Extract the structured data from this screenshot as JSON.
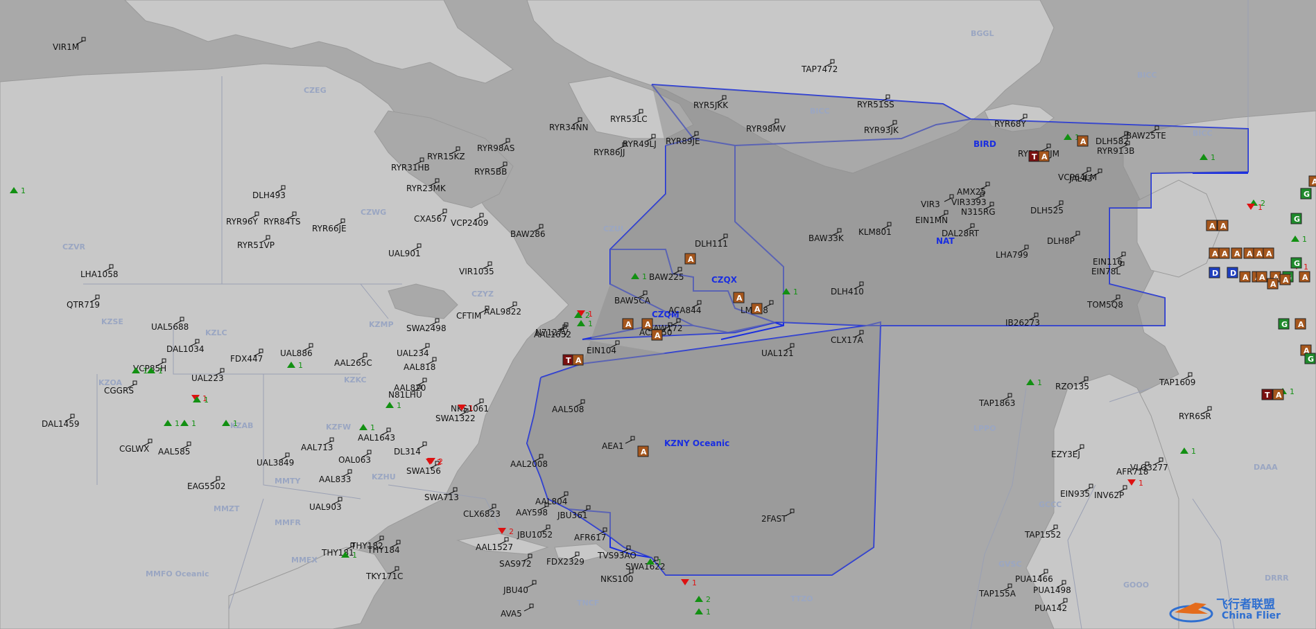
{
  "fir_labels": [
    "BGGL",
    "BICC",
    "BICC",
    "BICC",
    "CZEG",
    "CZWG",
    "CZVR",
    "CZUL",
    "CZYZ",
    "KZSE",
    "KZLC",
    "KZMP",
    "KZOA",
    "KZAB",
    "KZKC",
    "KZFW",
    "KZHU",
    "MMTY",
    "MMZT",
    "MMFR",
    "MMEX",
    "MMFO Oceanic",
    "TTZO",
    "TNCF",
    "LPPO",
    "GCCC",
    "GVSC",
    "GOOO",
    "DAAA",
    "DRRR",
    "CZQX",
    "NAT",
    "KZNY Oceanic",
    "BIRD",
    "CZQM"
  ],
  "flights": [
    "VIR1M",
    "RYR51SS",
    "RYR93JK",
    "RYR34NN",
    "RYR53LC",
    "RYR5JKK",
    "RYR98MV",
    "RYR89JE",
    "RYR49LJ",
    "RYR86JJ",
    "RYR98AS",
    "RYR15KZ",
    "RYR31HB",
    "RYR5BB",
    "RYR23MK",
    "DLH493",
    "RYR96Y",
    "RYR84TS",
    "RYR66JE",
    "RYR51VP",
    "CXA567",
    "VCP2409",
    "BAW286",
    "UAL901",
    "VIR1035",
    "DLH111",
    "BAW225",
    "BAW5CA",
    "ACA844",
    "LM508",
    "BAW172",
    "ACA250",
    "EIN104",
    "LHA1058",
    "QTR719",
    "UAL5688",
    "DAL1034",
    "FDX447",
    "UAL886",
    "AAL265C",
    "UAL223",
    "VCP85H",
    "CGGRS",
    "DAL1459",
    "CGLWX",
    "AAL585",
    "UAL3849",
    "EAG5502",
    "UAL903",
    "THY181",
    "THY182",
    "THY184",
    "TKY171C",
    "AAL833",
    "OAL063",
    "AAL713",
    "AAL1643",
    "DL314",
    "SWA156",
    "SWA713",
    "CLX6823",
    "AAL1527",
    "SAS972",
    "FDX2329",
    "JBU40",
    "AVA5",
    "NKS100",
    "SWA1622",
    "TVS93AO",
    "AFR617",
    "JBU1052",
    "AAY598",
    "JBU361",
    "AAL804",
    "AAL2008",
    "AAL508",
    "AEA1",
    "2FAST",
    "UAL121",
    "CLX17A",
    "DLH410",
    "BAW33K",
    "KLM801",
    "VIR3",
    "VIR3393",
    "DAL28RT",
    "EIN1MN",
    "AMX25",
    "N315RG",
    "DLH525",
    "DLH8P",
    "LHA799",
    "IB26273",
    "TOM5Q8",
    "EIN78L",
    "EIN116",
    "TAP1863",
    "RZO135",
    "EZY3EJ",
    "EIN935",
    "INV62P",
    "AFR718",
    "VLG3277",
    "TAP1552",
    "PUA1466",
    "PUA1498",
    "TAP155A",
    "PUA142",
    "BAW25TE",
    "DLH582",
    "RYR913B",
    "VCP64LM",
    "JAL43",
    "RYR68Y",
    "RYR138JM",
    "RYR6SR",
    "TAP1609",
    "SWA2498",
    "NKS1061",
    "N81LHU",
    "AAL820",
    "SWA1322",
    "AAL818",
    "UAL234",
    "CFTIM",
    "AAL9822",
    "N7127V",
    "AAL1652",
    "TAP7472"
  ],
  "alert_badges": [
    "A",
    "T",
    "D",
    "G"
  ],
  "alert_counts": [
    "1",
    "2"
  ],
  "colors": {
    "water": "#a9a9a9",
    "land": "#c8c8c8",
    "oceanic_boundary": "#1a2ee0",
    "fir_label": "#9aa6c2",
    "up_marker": "#129012",
    "down_marker": "#dd1111",
    "badge_a": "#a6571d",
    "badge_t": "#7a1010",
    "badge_g": "#1f8a2c",
    "badge_d": "#2040c0"
  },
  "watermark": {
    "logo_icon": "plane-logo-icon",
    "text_cn": "飞行者联盟",
    "text_en": "China Flier"
  }
}
